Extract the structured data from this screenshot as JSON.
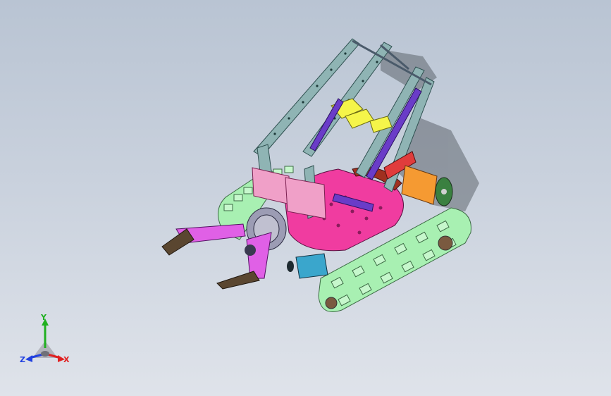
{
  "viewport": {
    "background_top": "#b9c4d3",
    "background_bottom": "#dfe3ea"
  },
  "model": {
    "description_icon": "robot-tank-assembly-icon",
    "colors": {
      "track": "#a8f0b2",
      "frame": "#8fb4b4",
      "base": "#f03ca0",
      "gripper": "#e060e6",
      "motor_orange": "#f59a32",
      "motor_blue": "#3aa6cc",
      "bracket_yellow": "#f5f54a",
      "arm_purple": "#6a3cc8",
      "bracket_pink": "#f0a0c8",
      "red_block": "#e03c3c",
      "claw_tip": "#5a4630"
    }
  },
  "triad": {
    "y_label": "Y",
    "x_label": "X",
    "z_label": "Z",
    "x_color": "#e02020",
    "y_color": "#20b020",
    "z_color": "#2040e0"
  }
}
